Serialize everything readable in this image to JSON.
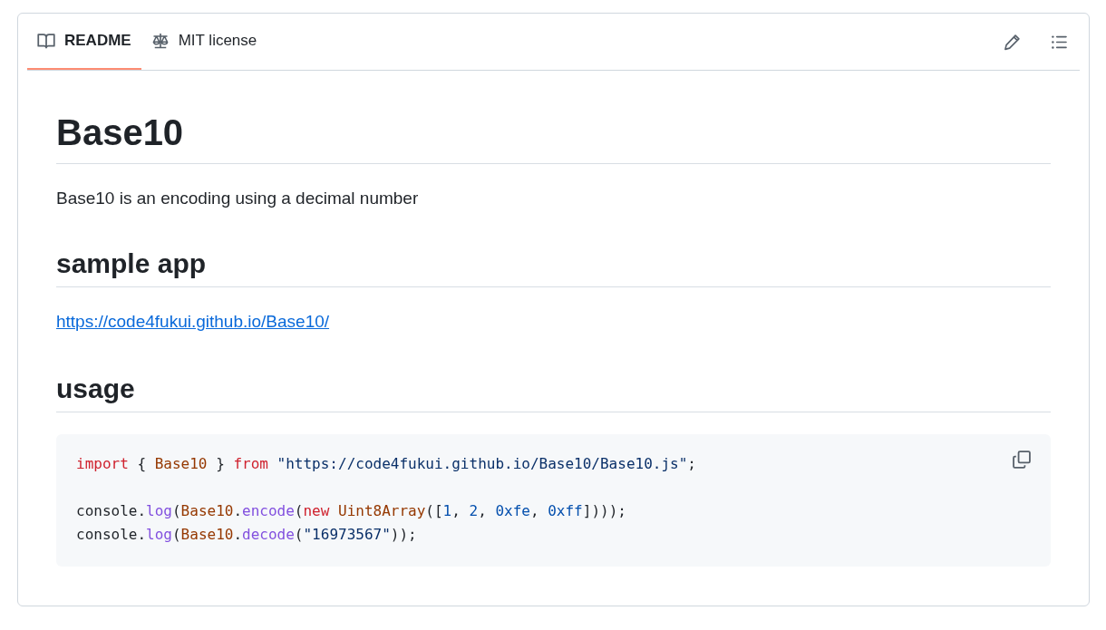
{
  "tabs": [
    {
      "label": "README",
      "selected": true
    },
    {
      "label": "MIT license",
      "selected": false
    }
  ],
  "readme": {
    "title": "Base10",
    "description": "Base10 is an encoding using a decimal number",
    "sections": [
      {
        "heading": "sample app",
        "link": "https://code4fukui.github.io/Base10/"
      },
      {
        "heading": "usage",
        "code": [
          [
            [
              {
                "text": "import",
                "kind": "keyword"
              },
              {
                "text": " { ",
                "kind": "plain"
              },
              {
                "text": "Base10",
                "kind": "entity"
              },
              {
                "text": " } ",
                "kind": "plain"
              },
              {
                "text": "from",
                "kind": "keyword"
              },
              {
                "text": " \"https://code4fukui.github.io/Base10/Base10.js\"",
                "kind": "string"
              },
              {
                "text": ";",
                "kind": "plain"
              }
            ]
          ],
          [
            [
              {
                "text": "console.",
                "kind": "plain"
              },
              {
                "text": "log",
                "kind": "function"
              },
              {
                "text": "(",
                "kind": "plain"
              },
              {
                "text": "Base10",
                "kind": "entity"
              },
              {
                "text": ".",
                "kind": "plain"
              },
              {
                "text": "encode",
                "kind": "function"
              },
              {
                "text": "(",
                "kind": "plain"
              },
              {
                "text": "new ",
                "kind": "keyword"
              },
              {
                "text": "Uint8Array",
                "kind": "entity"
              },
              {
                "text": "([",
                "kind": "plain"
              },
              {
                "text": "1",
                "kind": "constant"
              },
              {
                "text": ", ",
                "kind": "plain"
              },
              {
                "text": "2",
                "kind": "constant"
              },
              {
                "text": ", ",
                "kind": "plain"
              },
              {
                "text": "0xfe",
                "kind": "constant"
              },
              {
                "text": ", ",
                "kind": "plain"
              },
              {
                "text": "0xff",
                "kind": "constant"
              },
              {
                "text": "])));",
                "kind": "plain"
              }
            ],
            [
              {
                "text": "console.",
                "kind": "plain"
              },
              {
                "text": "log",
                "kind": "function"
              },
              {
                "text": "(",
                "kind": "plain"
              },
              {
                "text": "Base10",
                "kind": "entity"
              },
              {
                "text": ".",
                "kind": "plain"
              },
              {
                "text": "decode",
                "kind": "function"
              },
              {
                "text": "(",
                "kind": "plain"
              },
              {
                "text": "\"16973567\"",
                "kind": "string"
              },
              {
                "text": "));",
                "kind": "plain"
              }
            ]
          ]
        ]
      }
    ]
  }
}
